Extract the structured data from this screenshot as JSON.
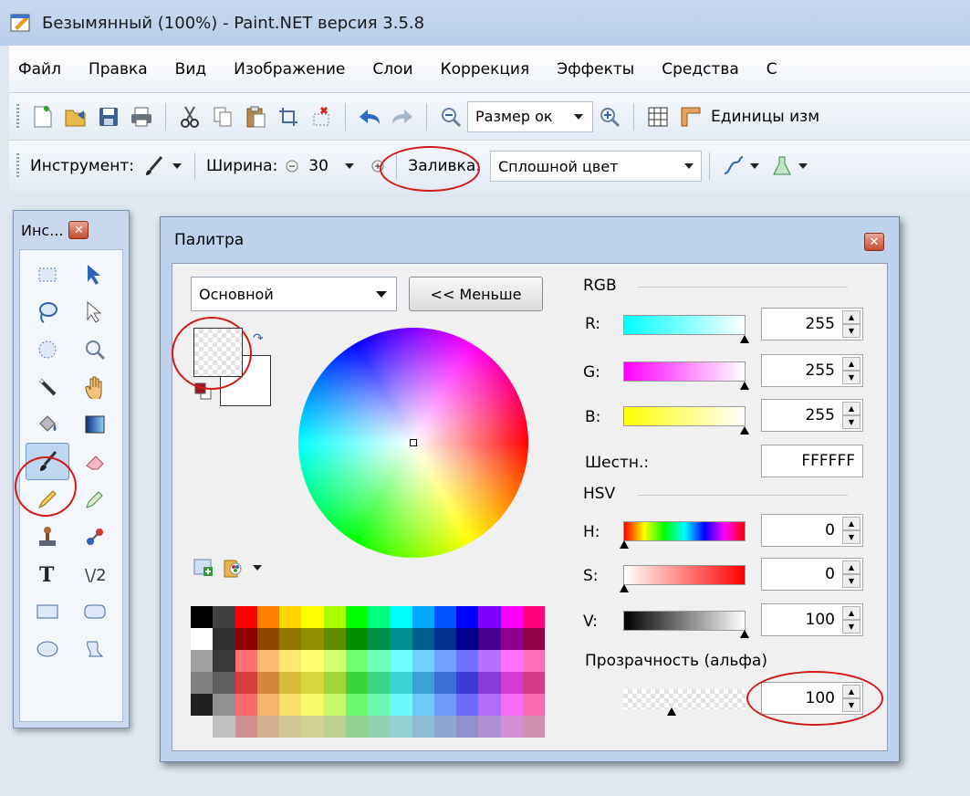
{
  "window": {
    "title": "Безымянный (100%) - Paint.NET версия 3.5.8"
  },
  "menu": [
    "Файл",
    "Правка",
    "Вид",
    "Изображение",
    "Слои",
    "Коррекция",
    "Эффекты",
    "Средства",
    "С"
  ],
  "toolbar1": {
    "zoom_dropdown": "Размер ок",
    "units_label": "Единицы изм"
  },
  "toolbar2": {
    "tool_label": "Инструмент:",
    "width_label": "Ширина:",
    "width_value": "30",
    "fill_label": "Заливка:",
    "fill_value": "Сплошной цвет"
  },
  "tools_panel": {
    "title": "Инс..."
  },
  "palette": {
    "title": "Палитра",
    "mode": "Основной",
    "less_button": "<< Меньше",
    "rgb_label": "RGB",
    "hsv_label": "HSV",
    "r_label": "R:",
    "g_label": "G:",
    "b_label": "B:",
    "r": "255",
    "g": "255",
    "b": "255",
    "hex_label": "Шестн.:",
    "hex": "FFFFFF",
    "h_label": "H:",
    "s_label": "S:",
    "v_label": "V:",
    "h": "0",
    "s": "0",
    "v": "100",
    "alpha_label": "Прозрачность (альфа)",
    "alpha": "100"
  },
  "colors": {
    "highlight": "#d31a1a",
    "accent": "#2d63b8"
  }
}
